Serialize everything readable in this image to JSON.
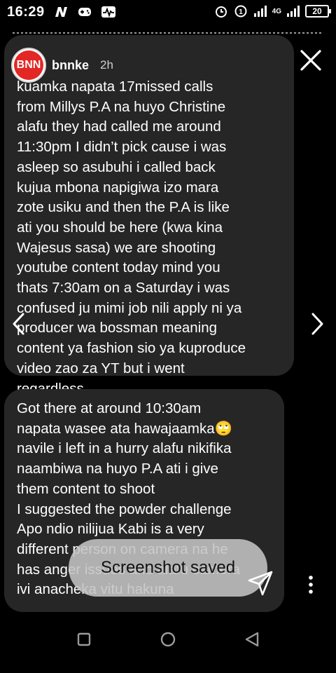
{
  "status_bar": {
    "time": "16:29",
    "battery": "20",
    "network": "4G"
  },
  "story": {
    "username": "bnnke",
    "time_ago": "2h",
    "avatar_text": "BNN",
    "message_1_lines": [
      "kuamka napata 17missed calls",
      "from Millys P.A na huyo Christine",
      "alafu they had called me around",
      "11:30pm I didn’t pick cause i was",
      "asleep so asubuhi i called back",
      "kujua mbona napigiwa izo mara",
      "zote usiku and then the P.A is like",
      "ati you should be here (kwa kina",
      "Wajesus sasa) we are shooting",
      "youtube content today mind you",
      "thats 7:30am on a Saturday i was",
      "confused ju mimi job nili apply ni ya",
      "producer wa bossman meaning",
      "content ya fashion sio ya kuproduce",
      "video zao za YT but i went",
      "regardless"
    ],
    "message_2_lines": [
      "Got there at around 10:30am",
      "napata wasee ata hawajaamka🙄",
      "navile i left in a hurry alafu nikifika",
      "naambiwa na huyo P.A ati i give",
      "them content to shoot",
      "I suggested the powder challenge",
      "Apo ndio nilijua Kabi is a very",
      "different person on camera na he",
      "has anger issues and alafu camera",
      "ivi anacheka vitu hakuna"
    ]
  },
  "toast": {
    "text": "Screenshot saved"
  },
  "icons": {
    "close": "close-icon",
    "prev": "chevron-left-icon",
    "next": "chevron-right-icon",
    "send": "send-icon",
    "more": "more-vertical-icon"
  }
}
